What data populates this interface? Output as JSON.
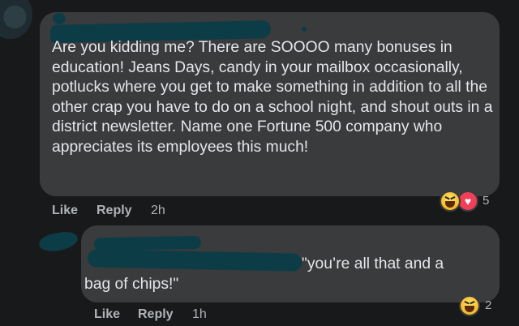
{
  "comments": [
    {
      "body": "Are you kidding me? There are SOOOO many bonuses in education! Jeans Days, candy in your mailbox occasionally, potlucks where you get to make something in addition to all the other crap you have to do on a school night, and shout outs in a district newsletter. Name one Fortune 500 company who appreciates its employees this much!",
      "like_label": "Like",
      "reply_label": "Reply",
      "time": "2h",
      "reactions": {
        "icons": [
          "haha-icon",
          "love-icon"
        ],
        "count": "5"
      }
    },
    {
      "body_line1": "\"you’re all that and a",
      "body_line2": "bag of chips!\"",
      "like_label": "Like",
      "reply_label": "Reply",
      "time": "1h",
      "reactions": {
        "icons": [
          "haha-icon"
        ],
        "count": "2"
      }
    }
  ],
  "colors": {
    "background": "#18191a",
    "bubble": "#3a3b3c",
    "text": "#e4e6eb",
    "secondary_text": "#b0b3b8",
    "redaction": "#0c3c46"
  }
}
